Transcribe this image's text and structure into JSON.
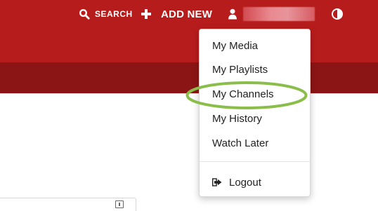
{
  "header": {
    "search_label": "SEARCH",
    "add_new_label": "ADD NEW"
  },
  "user_menu": {
    "items": [
      {
        "label": "My Media"
      },
      {
        "label": "My Playlists"
      },
      {
        "label": "My Channels"
      },
      {
        "label": "My History"
      },
      {
        "label": "Watch Later"
      }
    ],
    "logout_label": "Logout"
  },
  "icons": {
    "search": "search-icon",
    "add": "plus-icon",
    "user": "user-icon",
    "contrast": "contrast-icon",
    "logout": "logout-icon",
    "footer_small": "download-icon"
  },
  "colors": {
    "header_primary": "#b71c1c",
    "header_secondary": "#8b1515",
    "highlight": "#8bbd4a",
    "menu_text": "#222222"
  }
}
